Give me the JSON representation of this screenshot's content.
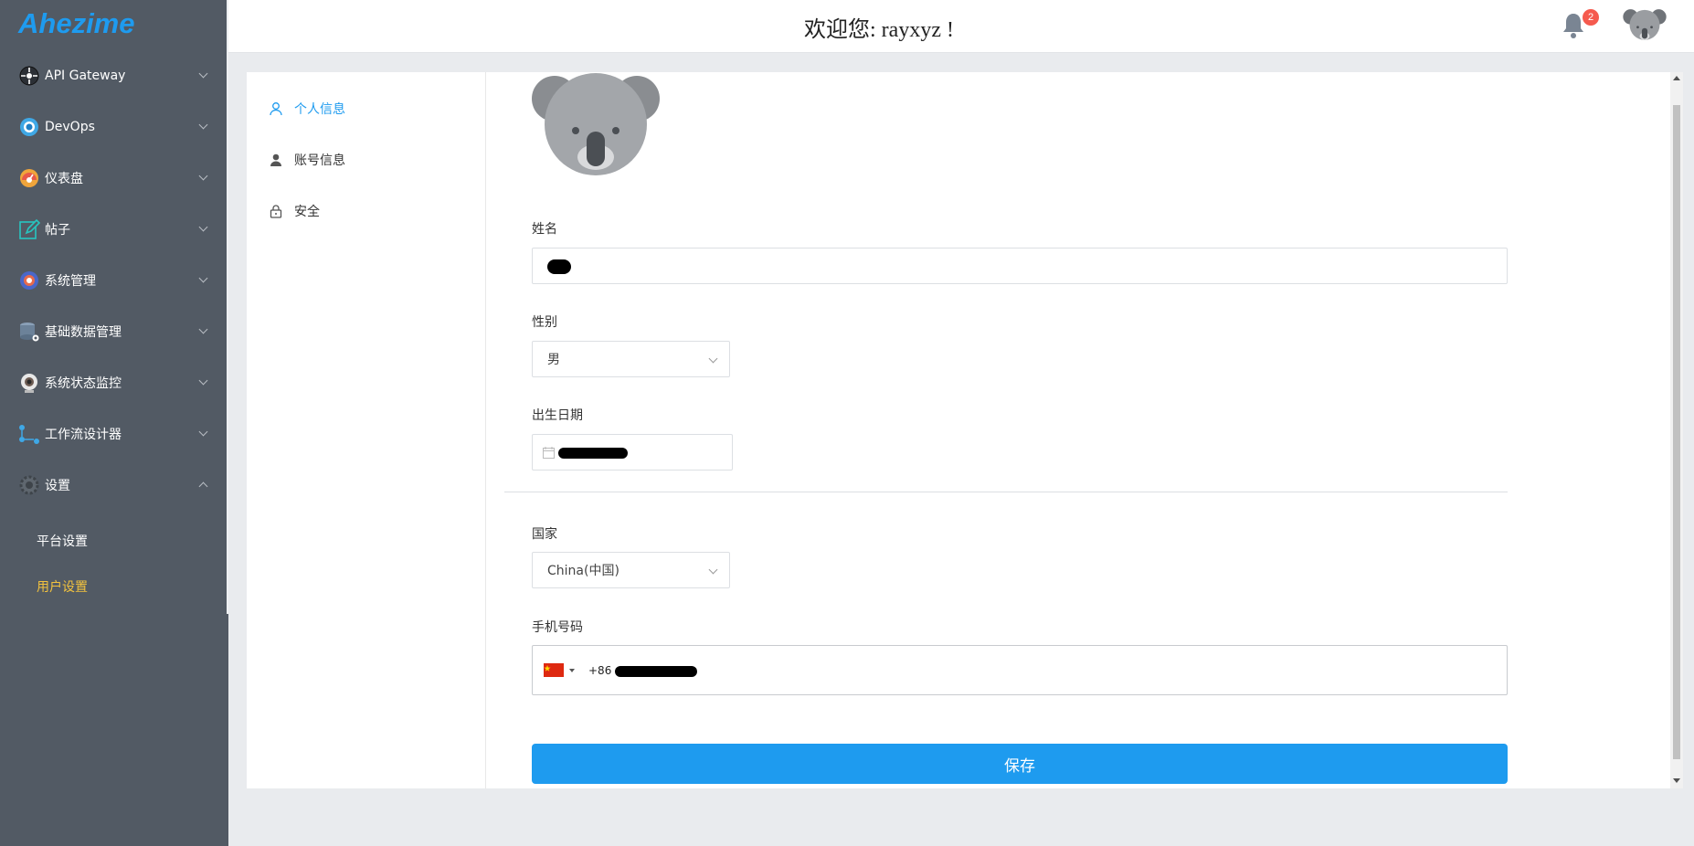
{
  "app": {
    "logo": "Ahezime"
  },
  "sidebar": {
    "items": [
      {
        "label": "API Gateway",
        "icon": "api-gateway-icon"
      },
      {
        "label": "DevOps",
        "icon": "devops-icon"
      },
      {
        "label": "仪表盘",
        "icon": "dashboard-icon"
      },
      {
        "label": "帖子",
        "icon": "edit-icon"
      },
      {
        "label": "系统管理",
        "icon": "system-management-icon"
      },
      {
        "label": "基础数据管理",
        "icon": "database-icon"
      },
      {
        "label": "系统状态监控",
        "icon": "webcam-icon"
      },
      {
        "label": "工作流设计器",
        "icon": "workflow-icon"
      },
      {
        "label": "设置",
        "icon": "gear-icon"
      }
    ],
    "submenu": [
      {
        "label": "平台设置"
      },
      {
        "label": "用户设置"
      }
    ],
    "active_color": "#f2c23e"
  },
  "header": {
    "title": "欢迎您: rayxyz !",
    "notification_count": "2"
  },
  "tabs": [
    {
      "label": "个人信息"
    },
    {
      "label": "账号信息"
    },
    {
      "label": "安全"
    }
  ],
  "form": {
    "name_label": "姓名",
    "gender_label": "性别",
    "gender_value": "男",
    "birthdate_label": "出生日期",
    "country_label": "国家",
    "country_value": "China(中国)",
    "phone_label": "手机号码",
    "phone_prefix": "+86",
    "save_label": "保存"
  },
  "colors": {
    "accent": "#1e9bef",
    "sidebar_bg": "#525a64",
    "badge": "#f55a4e"
  }
}
